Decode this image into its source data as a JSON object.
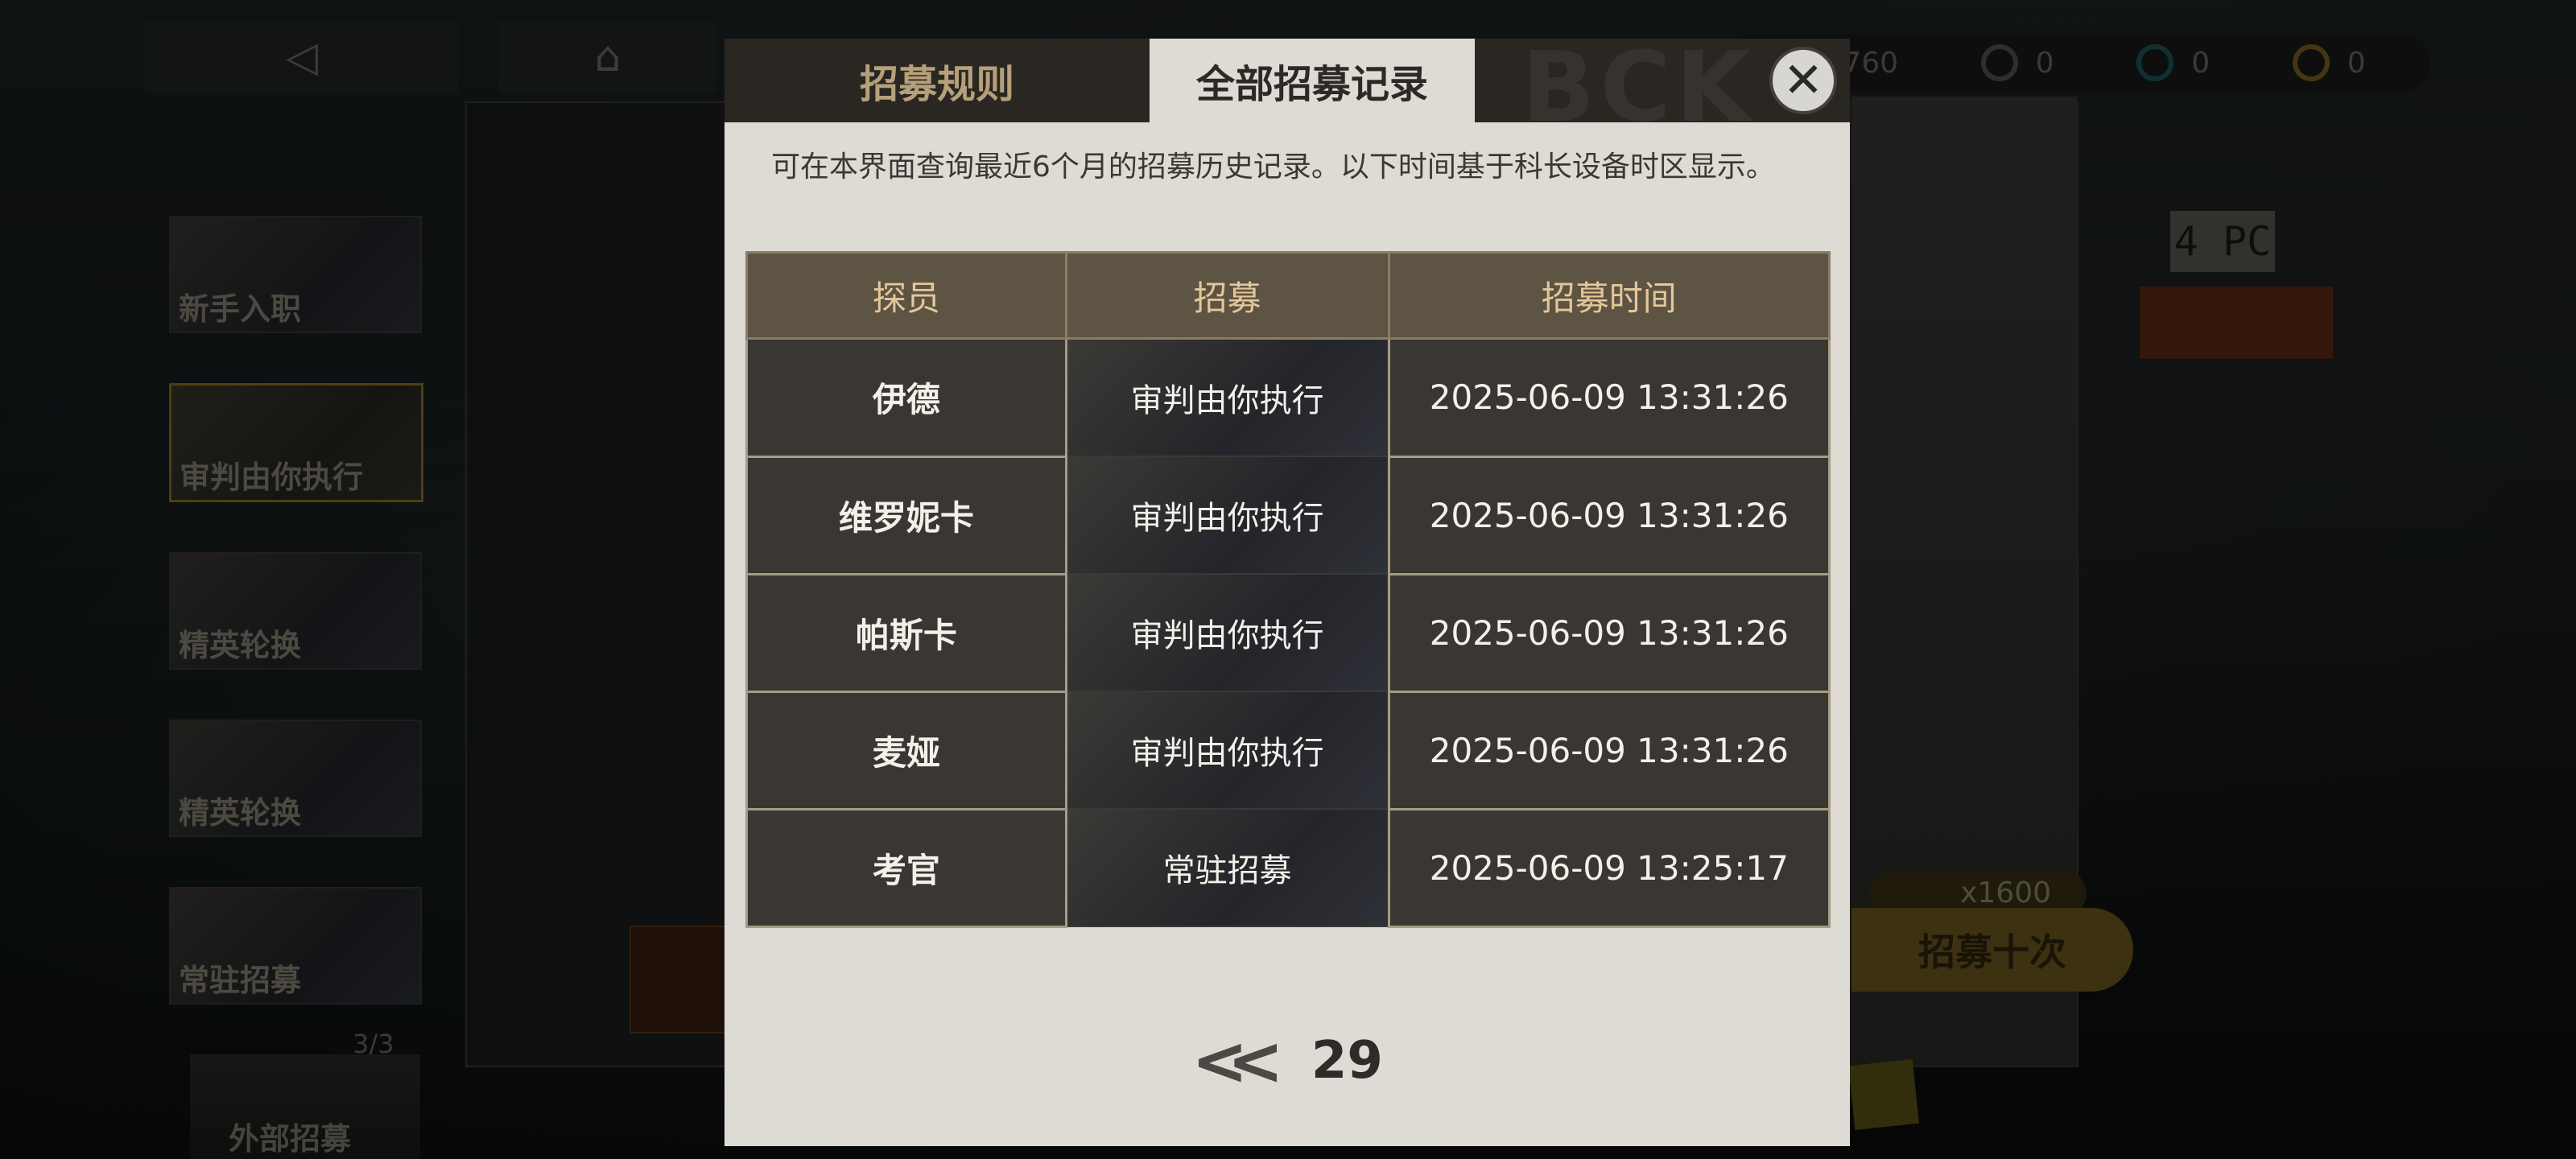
{
  "currency": [
    {
      "icon": "orange-coin-icon",
      "value": "760",
      "color": "#7a4a20"
    },
    {
      "icon": "gray-token-icon",
      "value": "0",
      "color": "#555550"
    },
    {
      "icon": "teal-token-icon",
      "value": "0",
      "color": "#1f5a5a"
    },
    {
      "icon": "gold-token-icon",
      "value": "0",
      "color": "#7a6420"
    }
  ],
  "sidebar": {
    "banners": [
      {
        "label": "新手入职"
      },
      {
        "label": "审判由你执行"
      },
      {
        "label": "精英轮换"
      },
      {
        "label": "精英轮换"
      },
      {
        "label": "常驻招募"
      }
    ],
    "counter": "3/3",
    "external_label": "外部招募"
  },
  "background": {
    "tag_text": "4 PC",
    "multi_cost": "x1600",
    "recruit_ten_label": "招募十次"
  },
  "modal": {
    "tabs": [
      {
        "label": "招募规则"
      },
      {
        "label": "全部招募记录"
      }
    ],
    "watermark": "BCK",
    "close_glyph": "✕",
    "notice": "可在本界面查询最近6个月的招募历史记录。以下时间基于科长设备时区显示。",
    "table": {
      "headers": [
        "探员",
        "招募",
        "招募时间"
      ],
      "rows": [
        [
          "伊德",
          "审判由你执行",
          "2025-06-09 13:31:26"
        ],
        [
          "维罗妮卡",
          "审判由你执行",
          "2025-06-09 13:31:26"
        ],
        [
          "帕斯卡",
          "审判由你执行",
          "2025-06-09 13:31:26"
        ],
        [
          "麦娅",
          "审判由你执行",
          "2025-06-09 13:31:26"
        ],
        [
          "考官",
          "常驻招募",
          "2025-06-09 13:25:17"
        ]
      ]
    },
    "pager": {
      "prev_glyph": "<<",
      "page": "29"
    }
  }
}
